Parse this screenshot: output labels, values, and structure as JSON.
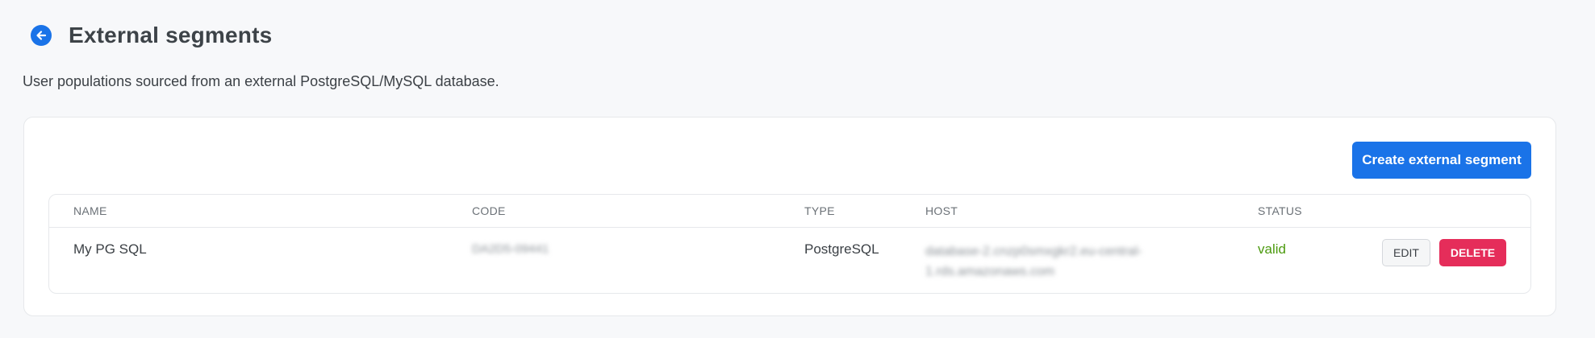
{
  "header": {
    "back_icon": "arrow-left-circle-icon",
    "title": "External segments"
  },
  "subtitle": "User populations sourced from an external PostgreSQL/MySQL database.",
  "actions": {
    "create_label": "Create external segment"
  },
  "table": {
    "columns": [
      "NAME",
      "CODE",
      "TYPE",
      "HOST",
      "STATUS"
    ],
    "rows": [
      {
        "name": "My PG SQL",
        "code": "DA2D5-09441",
        "type": "PostgreSQL",
        "host_line1": "database-2.cnzp0smxgkr2.eu-central-",
        "host_line2": "1.rds.amazonaws.com",
        "status": "valid",
        "edit_label": "EDIT",
        "delete_label": "DELETE"
      }
    ]
  },
  "colors": {
    "accent": "#1a73e8",
    "danger": "#e52d5a",
    "status_valid": "#4c9a0f"
  }
}
